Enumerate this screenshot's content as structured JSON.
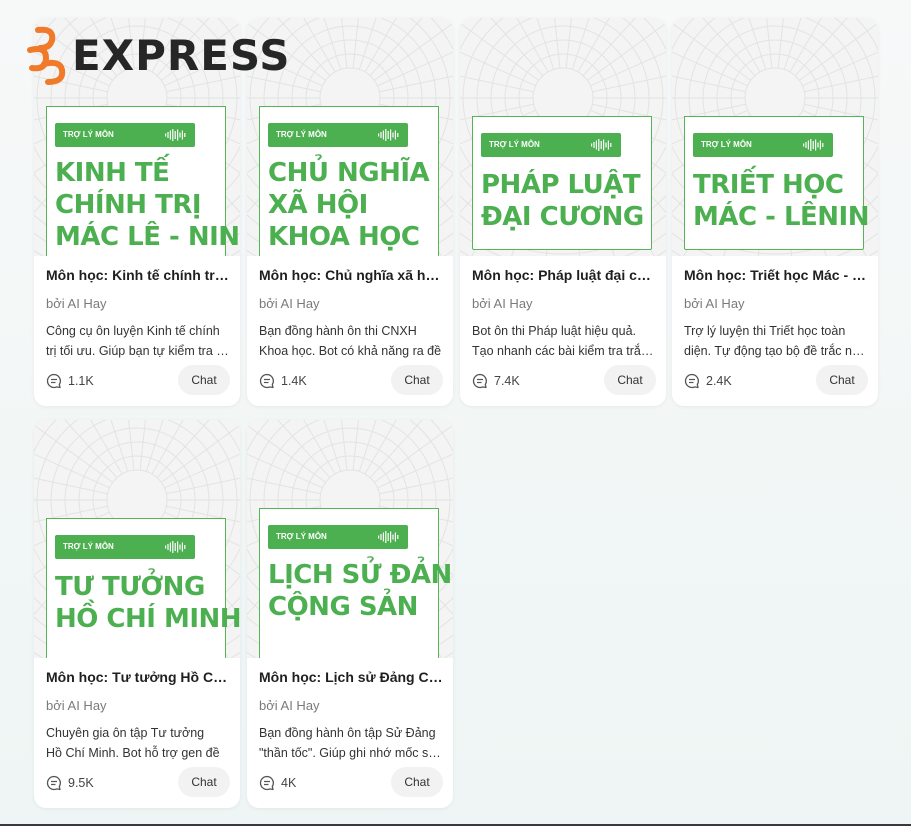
{
  "brand": {
    "logo_text": "EXPRESS",
    "accent": "#f07a2a"
  },
  "badge_label": "TRỢ LÝ MÔN",
  "chat_label": "Chat",
  "colors": {
    "green": "#4caf50",
    "card_bg": "#ffffff"
  },
  "cards": [
    {
      "title_lines": [
        "KINH TẾ",
        "CHÍNH TRỊ",
        "MÁC LÊ - NIN"
      ],
      "name": "Môn học: Kinh tế chính trị Mác Lê - Nin",
      "author": "bởi AI Hay",
      "desc_lines": [
        "Công cụ ôn luyện Kinh tế chính",
        "trị tối ưu. Giúp bạn tự kiểm tra kiến thức"
      ],
      "count": "1.1K"
    },
    {
      "title_lines": [
        "CHỦ NGHĨA",
        "XÃ HỘI",
        "KHOA HỌC"
      ],
      "name": "Môn học: Chủ nghĩa xã hội khoa học",
      "author": "bởi AI Hay",
      "desc_lines": [
        "Bạn đồng hành ôn thi CNXH",
        "Khoa học. Bot có khả năng ra đề"
      ],
      "count": "1.4K"
    },
    {
      "title_lines": [
        "PHÁP LUẬT",
        "ĐẠI CƯƠNG"
      ],
      "name": "Môn học: Pháp luật đại cương",
      "author": "bởi AI Hay",
      "desc_lines": [
        "Bot ôn thi Pháp luật hiệu quả.",
        "Tạo nhanh các bài kiểm tra trắc nghiệm"
      ],
      "count": "7.4K"
    },
    {
      "title_lines": [
        "TRIẾT HỌC",
        "MÁC - LÊNIN"
      ],
      "name": "Môn học: Triết học Mác - Lênin",
      "author": "bởi AI Hay",
      "desc_lines": [
        "Trợ lý luyện thi Triết học toàn",
        "diện. Tự động tạo bộ đề trắc nghiệm"
      ],
      "count": "2.4K"
    },
    {
      "title_lines": [
        "TƯ TƯỞNG",
        "HỒ CHÍ MINH"
      ],
      "name": "Môn học: Tư tưởng Hồ Chí Minh",
      "author": "bởi AI Hay",
      "desc_lines": [
        "Chuyên gia ôn tập Tư tưởng",
        "Hồ Chí Minh. Bot hỗ trợ gen đề"
      ],
      "count": "9.5K"
    },
    {
      "title_lines": [
        "LỊCH SỬ ĐẢNG",
        "CỘNG SẢN"
      ],
      "name": "Môn học: Lịch sử Đảng Cộng sản",
      "author": "bởi AI Hay",
      "desc_lines": [
        "Bạn đồng hành ôn tập Sử Đảng",
        "\"thần tốc\". Giúp ghi nhớ mốc sự kiện"
      ],
      "count": "4K"
    }
  ]
}
